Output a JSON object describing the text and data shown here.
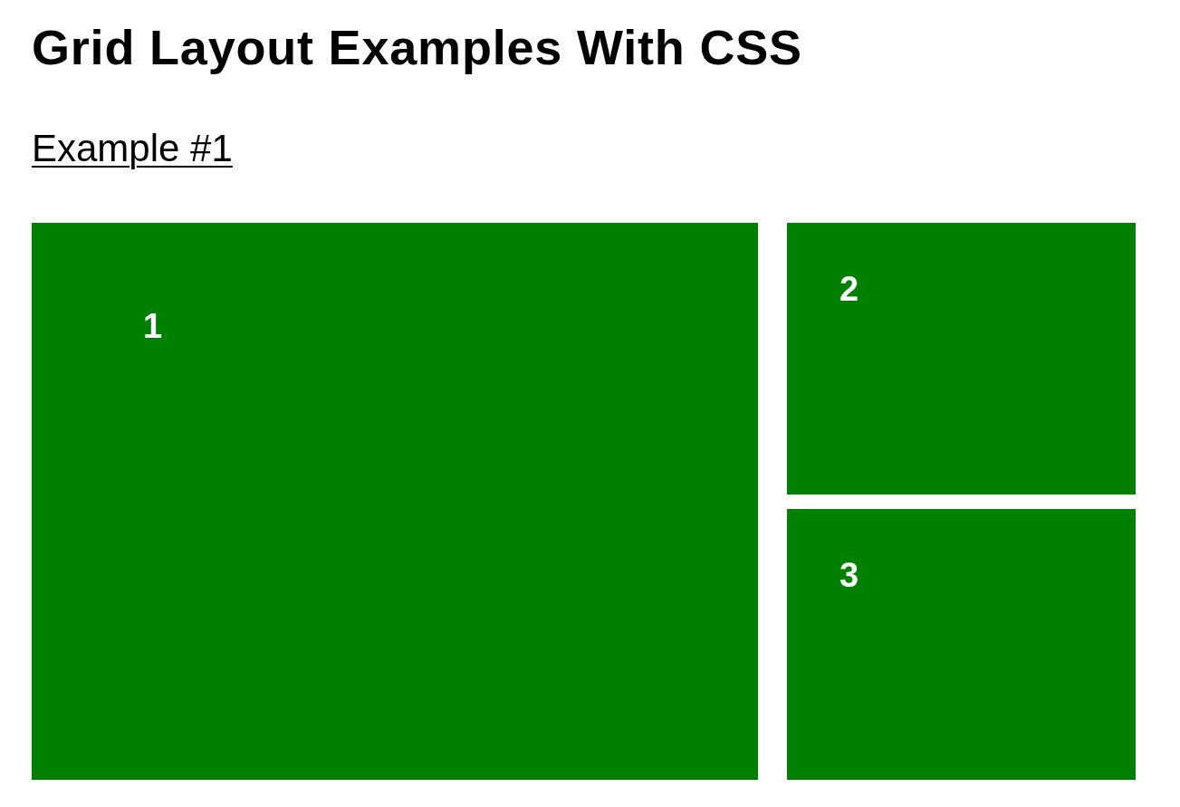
{
  "title": "Grid Layout Examples With CSS",
  "example_link": "Example #1",
  "grid_items": [
    {
      "label": "1"
    },
    {
      "label": "2"
    },
    {
      "label": "3"
    }
  ]
}
